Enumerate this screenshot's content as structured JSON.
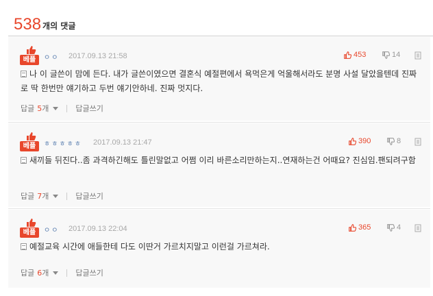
{
  "header": {
    "count": "538",
    "label": "개의 댓글"
  },
  "comments": [
    {
      "badge": "베플",
      "nickname": "ㅇㅇ",
      "date": "2017.09.13 21:58",
      "likes": "453",
      "dislikes": "14",
      "text": "나 이 글쓴이 맘에 든다. 내가 글쓴이였으면 결혼식 예절편에서 욕먹은게 억울해서라도 분명 사설 달았을텐데 진짜로 딱 한번만 얘기하고 두번 얘기안하네. 진짜 멋지다.",
      "reply_label": "답글",
      "reply_count": "5",
      "reply_unit": "개",
      "write_label": "답글쓰기"
    },
    {
      "badge": "베플",
      "nickname": "ㅎㅎㅎㅎㅎ",
      "date": "2017.09.13 21:47",
      "likes": "390",
      "dislikes": "8",
      "text": "새끼들 뒤진다..좀 과격하긴해도 틀린말없고 어쩜 이리 바른소리만하는지..연재하는건 어때요? 진심임.팬되려구함",
      "reply_label": "답글",
      "reply_count": "7",
      "reply_unit": "개",
      "write_label": "답글쓰기"
    },
    {
      "badge": "베플",
      "nickname": "ㅇㅇ",
      "date": "2017.09.13 22:04",
      "likes": "365",
      "dislikes": "4",
      "text": "예절교육 시간에 애들한테 다도 이딴거 가르치지말고 이런걸 가르쳐라.",
      "reply_label": "답글",
      "reply_count": "6",
      "reply_unit": "개",
      "write_label": "답글쓰기"
    }
  ],
  "colors": {
    "accent": "#e8472c",
    "nickname": "#5b7fb0",
    "muted": "#a8a8a8",
    "background": "#f8f8f8"
  },
  "icons": [
    "thumbs-up-icon",
    "thumbs-down-icon",
    "report-icon",
    "document-icon",
    "caret-down-icon"
  ]
}
